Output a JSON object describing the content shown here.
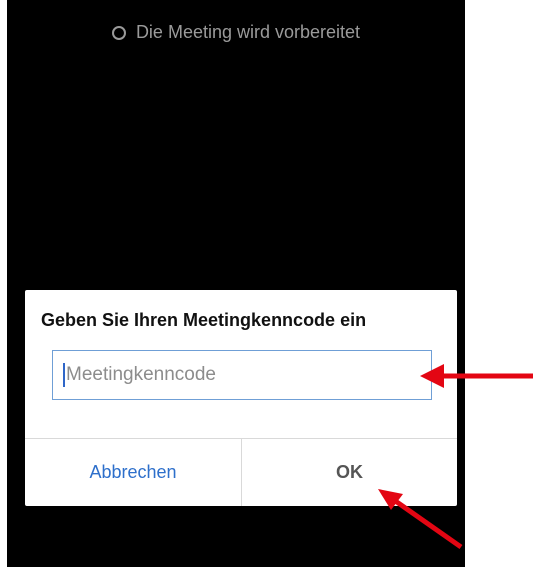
{
  "status": {
    "text": "Die Meeting wird vorbereitet",
    "icon": "spinner-icon"
  },
  "dialog": {
    "title": "Geben Sie Ihren Meetingkenncode ein",
    "input_value": "",
    "input_placeholder": "Meetingkenncode",
    "cancel_label": "Abbrechen",
    "ok_label": "OK"
  },
  "colors": {
    "background": "#000000",
    "dialog": "#ffffff",
    "link": "#2d6fcb",
    "annotation_arrow": "#e30613"
  }
}
